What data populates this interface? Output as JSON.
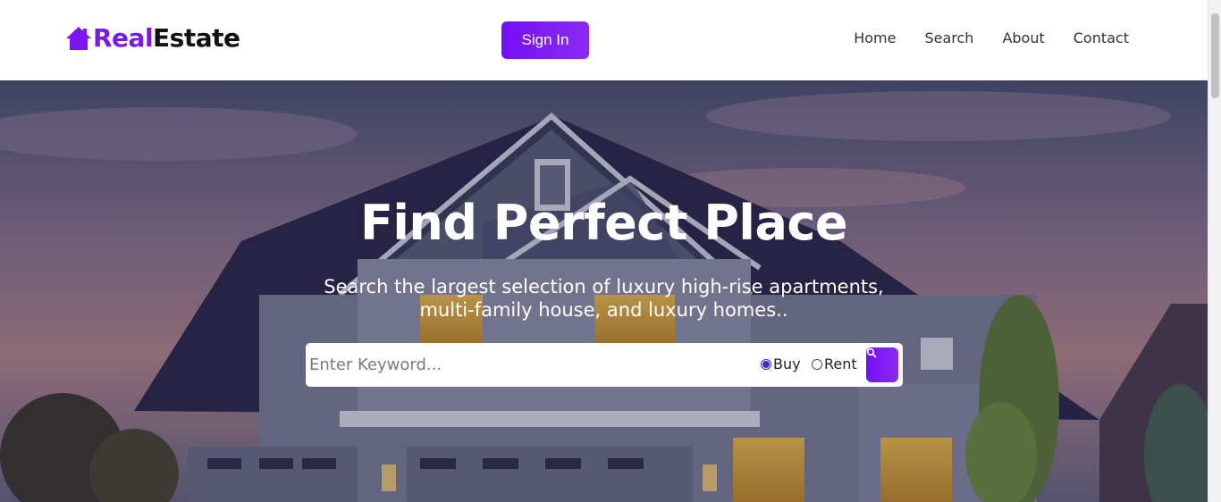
{
  "brand": {
    "part1": "Real",
    "part2": "Estate"
  },
  "header": {
    "signin_label": "Sign In"
  },
  "nav": {
    "items": [
      "Home",
      "Search",
      "About",
      "Contact"
    ]
  },
  "hero": {
    "title": "Find Perfect Place",
    "subtitle_line1": "Search the largest selection of luxury high-rise apartments,",
    "subtitle_line2": "multi-family house, and luxury homes.."
  },
  "search": {
    "placeholder": "Enter Keyword...",
    "options": [
      "Buy",
      "Rent"
    ],
    "selected": "Buy"
  },
  "colors": {
    "accent": "#7b16f0",
    "text": "#333333",
    "hero_text": "#ffffff"
  },
  "icons": {
    "logo": "house-icon",
    "search_button": "search-icon"
  }
}
